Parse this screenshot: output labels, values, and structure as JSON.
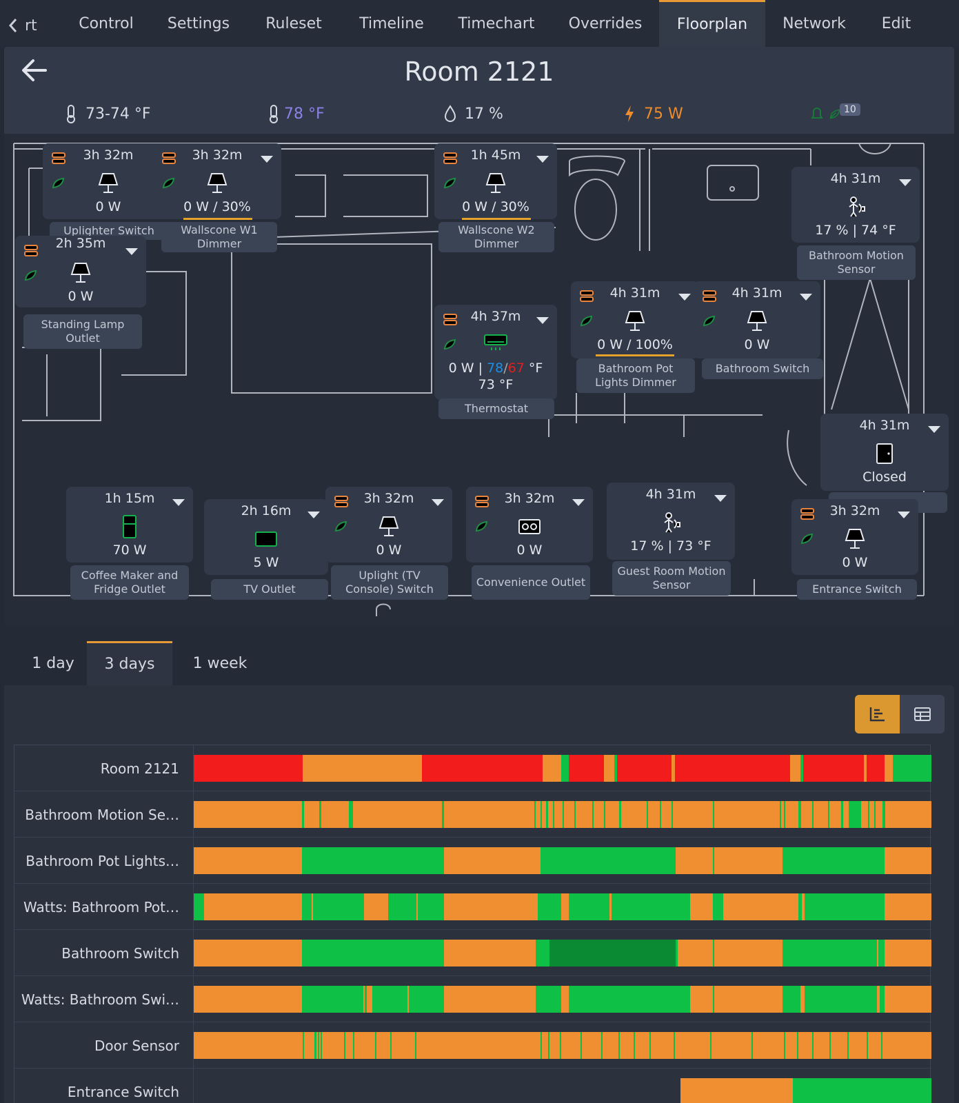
{
  "nav": {
    "back_label": "rt",
    "tabs": [
      "Control",
      "Settings",
      "Ruleset",
      "Timeline",
      "Timechart",
      "Overrides",
      "Floorplan",
      "Network",
      "Edit"
    ],
    "active_tab": "Floorplan"
  },
  "room": {
    "title": "Room 2121",
    "stats": {
      "temp_range": "73-74 °F",
      "setpoint": "78 °F",
      "humidity": "17 %",
      "power": "75 W",
      "badge_count": "10"
    }
  },
  "devices": {
    "uplighter": {
      "time": "3h 32m",
      "reading": "0 W",
      "label": "Uplighter Switch"
    },
    "wallscone_w1": {
      "time": "3h 32m",
      "reading": "0 W / 30%",
      "label": "Wallscone W1 Dimmer",
      "level": 0.3
    },
    "wallscone_w2": {
      "time": "1h 45m",
      "reading": "0 W / 30%",
      "label": "Wallscone W2 Dimmer",
      "level": 0.3
    },
    "standing_lamp": {
      "time": "2h 35m",
      "reading": "0 W",
      "label": "Standing Lamp Outlet"
    },
    "bathroom_motion": {
      "time": "4h 31m",
      "reading": "17 % | 74 °F",
      "label": "Bathroom Motion Sensor"
    },
    "thermostat": {
      "time": "4h 37m",
      "reading_power": "0 W |",
      "heat": "78",
      "cool": "67",
      "unit": "°F",
      "current": "73 °F",
      "label": "Thermostat"
    },
    "bathroom_pot": {
      "time": "4h 31m",
      "reading": "0 W / 100%",
      "label": "Bathroom Pot Lights Dimmer",
      "level": 1.0
    },
    "bathroom_switch": {
      "time": "4h 31m",
      "reading": "0 W",
      "label": "Bathroom Switch"
    },
    "door": {
      "time": "4h 31m",
      "reading": "Closed"
    },
    "coffee": {
      "time": "1h 15m",
      "reading": "70 W",
      "label": "Coffee Maker and Fridge Outlet"
    },
    "tv": {
      "time": "2h 16m",
      "reading": "5 W",
      "label": "TV Outlet"
    },
    "uplight_tv": {
      "time": "3h 32m",
      "reading": "0 W",
      "label": "Uplight (TV Console) Switch"
    },
    "convenience": {
      "time": "3h 32m",
      "reading": "0 W",
      "label": "Convenience Outlet"
    },
    "guest_motion": {
      "time": "4h 31m",
      "reading": "17 % | 73 °F",
      "label": "Guest Room Motion Sensor"
    },
    "entrance": {
      "time": "3h 32m",
      "reading": "0 W",
      "label": "Entrance Switch"
    }
  },
  "ranges": {
    "tabs": [
      "1 day",
      "3 days",
      "1 week"
    ],
    "active": "3 days"
  },
  "colors": {
    "accent": "#e79a36",
    "red": "#f21c1c",
    "orange": "#f08f32",
    "green": "#0ec045",
    "dark_green": "#0a8a33"
  },
  "timeline_rows": [
    {
      "name": "Room 2121",
      "segments": [
        [
          0,
          0.148,
          "red"
        ],
        [
          0.148,
          0.162,
          "orange"
        ],
        [
          0.166,
          0.17,
          "orange"
        ],
        [
          0.172,
          0.178,
          "orange"
        ],
        [
          0.216,
          0.23,
          "orange"
        ],
        [
          0.261,
          0.265,
          "orange"
        ],
        [
          0.289,
          0.302,
          "orange"
        ],
        [
          0.305,
          0.309,
          "orange"
        ],
        [
          0.309,
          0.473,
          "red"
        ],
        [
          0.473,
          0.498,
          "orange"
        ],
        [
          0.498,
          0.508,
          "green"
        ],
        [
          0.508,
          0.556,
          "red"
        ],
        [
          0.556,
          0.57,
          "orange"
        ],
        [
          0.57,
          0.574,
          "green"
        ],
        [
          0.574,
          0.648,
          "red"
        ],
        [
          0.648,
          0.652,
          "orange"
        ],
        [
          0.652,
          0.808,
          "red"
        ],
        [
          0.808,
          0.822,
          "orange"
        ],
        [
          0.822,
          0.826,
          "green"
        ],
        [
          0.826,
          0.908,
          "red"
        ],
        [
          0.908,
          0.912,
          "orange"
        ],
        [
          0.912,
          0.936,
          "red"
        ],
        [
          0.936,
          0.948,
          "orange"
        ],
        [
          0.948,
          1,
          "green"
        ]
      ]
    },
    {
      "name": "Bathroom Motion Se…",
      "segments": [
        [
          0.147,
          0.15,
          "green"
        ],
        [
          0.17,
          0.173,
          "green"
        ],
        [
          0.21,
          0.216,
          "green"
        ],
        [
          0.336,
          0.339,
          "green"
        ],
        [
          0.462,
          0.464,
          "green"
        ],
        [
          0.47,
          0.472,
          "green"
        ],
        [
          0.478,
          0.48,
          "green"
        ],
        [
          0.487,
          0.489,
          "green"
        ],
        [
          0.5,
          0.502,
          "green"
        ],
        [
          0.516,
          0.518,
          "green"
        ],
        [
          0.54,
          0.542,
          "green"
        ],
        [
          0.556,
          0.558,
          "green"
        ],
        [
          0.577,
          0.579,
          "green"
        ],
        [
          0.614,
          0.616,
          "green"
        ],
        [
          0.632,
          0.634,
          "green"
        ],
        [
          0.648,
          0.65,
          "green"
        ],
        [
          0.704,
          0.706,
          "green"
        ],
        [
          0.794,
          0.796,
          "green"
        ],
        [
          0.8,
          0.802,
          "green"
        ],
        [
          0.82,
          0.823,
          "green"
        ],
        [
          0.838,
          0.84,
          "green"
        ],
        [
          0.86,
          0.862,
          "green"
        ],
        [
          0.878,
          0.88,
          "green"
        ],
        [
          0.888,
          0.905,
          "green"
        ],
        [
          0.914,
          0.916,
          "green"
        ],
        [
          0.922,
          0.924,
          "green"
        ],
        [
          0.934,
          0.937,
          "green"
        ]
      ]
    },
    {
      "name": "Bathroom Pot Lights…",
      "segments": [
        [
          0.147,
          0.339,
          "green"
        ],
        [
          0.47,
          0.653,
          "green"
        ],
        [
          0.704,
          0.706,
          "green"
        ],
        [
          0.798,
          0.936,
          "green"
        ]
      ]
    },
    {
      "name": "Watts: Bathroom Pot…",
      "segments": [
        [
          0,
          0.014,
          "green"
        ],
        [
          0.147,
          0.16,
          "green"
        ],
        [
          0.162,
          0.231,
          "green"
        ],
        [
          0.264,
          0.302,
          "green"
        ],
        [
          0.304,
          0.339,
          "green"
        ],
        [
          0.466,
          0.498,
          "green"
        ],
        [
          0.508,
          0.564,
          "green"
        ],
        [
          0.566,
          0.673,
          "green"
        ],
        [
          0.704,
          0.718,
          "green"
        ],
        [
          0.82,
          0.824,
          "green"
        ],
        [
          0.828,
          0.936,
          "green"
        ]
      ]
    },
    {
      "name": "Bathroom Switch",
      "segments": [
        [
          0.147,
          0.339,
          "green"
        ],
        [
          0.464,
          0.482,
          "green"
        ],
        [
          0.482,
          0.653,
          "dark_green"
        ],
        [
          0.653,
          0.656,
          "green"
        ],
        [
          0.704,
          0.706,
          "green"
        ],
        [
          0.798,
          0.926,
          "green"
        ],
        [
          0.926,
          0.928,
          "orange"
        ],
        [
          0.928,
          0.936,
          "green"
        ]
      ]
    },
    {
      "name": "Watts: Bathroom Swi…",
      "segments": [
        [
          0.147,
          0.23,
          "green"
        ],
        [
          0.232,
          0.235,
          "green"
        ],
        [
          0.242,
          0.29,
          "green"
        ],
        [
          0.292,
          0.339,
          "green"
        ],
        [
          0.464,
          0.498,
          "green"
        ],
        [
          0.508,
          0.673,
          "green"
        ],
        [
          0.704,
          0.706,
          "green"
        ],
        [
          0.798,
          0.822,
          "green"
        ],
        [
          0.828,
          0.926,
          "green"
        ],
        [
          0.93,
          0.936,
          "green"
        ]
      ]
    },
    {
      "name": "Door Sensor",
      "segments": [
        [
          0.148,
          0.15,
          "green"
        ],
        [
          0.164,
          0.166,
          "green"
        ],
        [
          0.168,
          0.17,
          "green"
        ],
        [
          0.172,
          0.174,
          "green"
        ],
        [
          0.204,
          0.206,
          "green"
        ],
        [
          0.216,
          0.218,
          "green"
        ],
        [
          0.246,
          0.248,
          "green"
        ],
        [
          0.266,
          0.268,
          "green"
        ],
        [
          0.3,
          0.302,
          "green"
        ],
        [
          0.47,
          0.472,
          "green"
        ],
        [
          0.48,
          0.482,
          "green"
        ],
        [
          0.496,
          0.498,
          "green"
        ],
        [
          0.524,
          0.526,
          "green"
        ],
        [
          0.552,
          0.554,
          "green"
        ],
        [
          0.576,
          0.578,
          "green"
        ],
        [
          0.596,
          0.598,
          "green"
        ],
        [
          0.618,
          0.62,
          "green"
        ],
        [
          0.65,
          0.652,
          "green"
        ],
        [
          0.7,
          0.702,
          "green"
        ],
        [
          0.756,
          0.758,
          "green"
        ],
        [
          0.8,
          0.802,
          "green"
        ],
        [
          0.818,
          0.82,
          "green"
        ],
        [
          0.838,
          0.84,
          "green"
        ],
        [
          0.862,
          0.864,
          "green"
        ],
        [
          0.886,
          0.888,
          "green"
        ],
        [
          0.912,
          0.914,
          "green"
        ],
        [
          0.932,
          0.934,
          "green"
        ]
      ]
    },
    {
      "name": "Entrance Switch",
      "segments": []
    }
  ]
}
